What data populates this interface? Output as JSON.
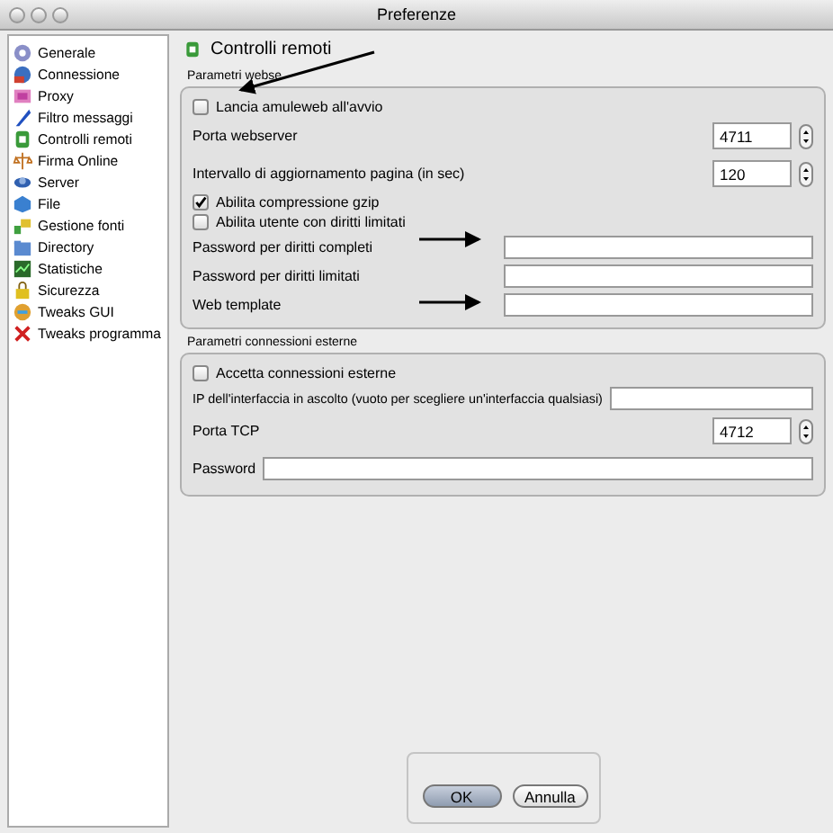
{
  "window": {
    "title": "Preferenze"
  },
  "sidebar": {
    "items": [
      {
        "label": "Generale"
      },
      {
        "label": "Connessione"
      },
      {
        "label": "Proxy"
      },
      {
        "label": "Filtro messaggi"
      },
      {
        "label": "Controlli remoti"
      },
      {
        "label": "Firma Online"
      },
      {
        "label": "Server"
      },
      {
        "label": "File"
      },
      {
        "label": "Gestione fonti"
      },
      {
        "label": "Directory"
      },
      {
        "label": "Statistiche"
      },
      {
        "label": "Sicurezza"
      },
      {
        "label": "Tweaks GUI"
      },
      {
        "label": "Tweaks programma"
      }
    ]
  },
  "page": {
    "title": "Controlli remoti"
  },
  "groups": [
    {
      "title": "Parametri webse",
      "rows": [
        {
          "kind": "checkbox",
          "label": "Lancia amuleweb all'avvio",
          "checked": false
        },
        {
          "kind": "spinner",
          "label": "Porta webserver",
          "value": "4711"
        },
        {
          "kind": "spinner",
          "label": "Intervallo di aggiornamento pagina (in sec)",
          "value": "120"
        },
        {
          "kind": "checkbox",
          "label": "Abilita compressione gzip",
          "checked": true
        },
        {
          "kind": "checkbox",
          "label": "Abilita utente con diritti limitati",
          "checked": false
        },
        {
          "kind": "field",
          "label": "Password per diritti completi"
        },
        {
          "kind": "field",
          "label": "Password per diritti limitati"
        },
        {
          "kind": "field",
          "label": "Web template"
        }
      ]
    },
    {
      "title": "Parametri connessioni esterne",
      "rows": [
        {
          "kind": "checkbox",
          "label": "Accetta connessioni esterne",
          "checked": false
        },
        {
          "kind": "field",
          "label": "IP dell'interfaccia in ascolto (vuoto per scegliere un'interfaccia qualsiasi)"
        },
        {
          "kind": "spinner",
          "label": "Porta TCP",
          "value": "4712"
        },
        {
          "kind": "inline",
          "label": "Password"
        }
      ]
    }
  ],
  "buttons": [
    {
      "label": "OK",
      "default": true
    },
    {
      "label": "Annulla",
      "default": false
    }
  ]
}
